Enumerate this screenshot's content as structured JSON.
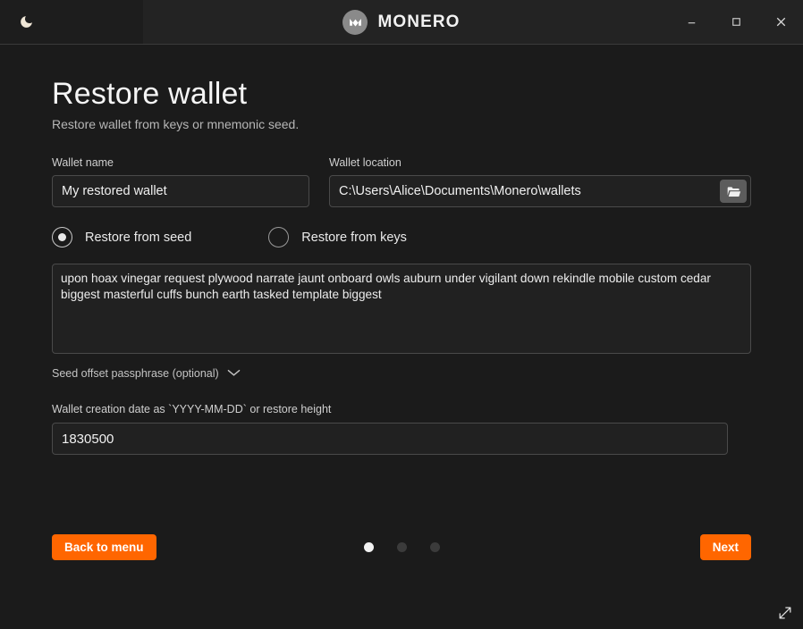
{
  "titlebar": {
    "theme_toggle_icon": "moon-icon",
    "brand_name": "MONERO",
    "logo_icon": "monero-logo-icon",
    "minimize_icon": "minimize-icon",
    "maximize_icon": "maximize-icon",
    "close_icon": "close-icon"
  },
  "page": {
    "title": "Restore wallet",
    "subtitle": "Restore wallet from keys or mnemonic seed."
  },
  "form": {
    "wallet_name": {
      "label": "Wallet name",
      "value": "My restored wallet"
    },
    "wallet_location": {
      "label": "Wallet location",
      "value": "C:\\Users\\Alice\\Documents\\Monero\\wallets",
      "browse_icon": "folder-open-icon"
    },
    "restore_mode": {
      "selected": "seed",
      "options": [
        {
          "id": "seed",
          "label": "Restore from seed",
          "selected": true
        },
        {
          "id": "keys",
          "label": "Restore from keys",
          "selected": false
        }
      ]
    },
    "seed": {
      "value": "upon hoax vinegar request plywood narrate jaunt onboard owls auburn under vigilant down rekindle mobile custom cedar biggest masterful cuffs bunch earth tasked template biggest"
    },
    "seed_offset": {
      "label": "Seed offset passphrase (optional)",
      "chevron_icon": "chevron-down-icon",
      "expanded": false
    },
    "restore_height": {
      "label": "Wallet creation date as `YYYY-MM-DD` or restore height",
      "value": "1830500"
    }
  },
  "footer": {
    "back_label": "Back to menu",
    "next_label": "Next",
    "pager": {
      "total": 3,
      "active_index": 0
    }
  },
  "colors": {
    "accent": "#ff6600",
    "background": "#1b1b1b",
    "titlebar": "#232323",
    "field_background": "#212121",
    "field_border": "#4a4a4a"
  },
  "resize_grip_icon": "resize-handle-icon"
}
